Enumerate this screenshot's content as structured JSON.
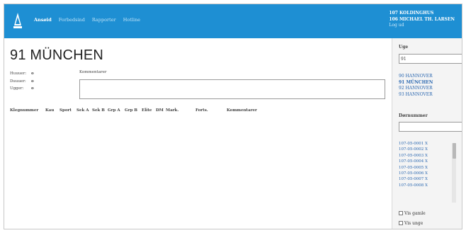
{
  "nav": {
    "items": [
      {
        "label": "Ansøid",
        "active": true
      },
      {
        "label": "Forbedsind",
        "active": false
      },
      {
        "label": "Rapporter",
        "active": false
      },
      {
        "label": "Hotline",
        "active": false
      }
    ]
  },
  "user": {
    "line1": "107 KOLDINGHUS",
    "line2": "106 MICHAEL TH. LARSEN",
    "logout": "Log ud"
  },
  "page_title": "91 MÜNCHEN",
  "meta": [
    {
      "label": "Huuuer:",
      "value": "o"
    },
    {
      "label": "Duuuer:",
      "value": "o"
    },
    {
      "label": "Ugger:",
      "value": "o"
    }
  ],
  "comment_label": "Kommentarer",
  "table_headers": [
    "Klegnummer",
    "Kau",
    "Sport",
    "Sek A",
    "Sek B",
    "Grp A",
    "Grp B",
    "Elite",
    "DM",
    "Mark.",
    "Forts.",
    "Kommentarer"
  ],
  "sidebar": {
    "uge_label": "Uge",
    "uge_value": "91",
    "uge_items": [
      {
        "label": "90 HANNOVER",
        "selected": false
      },
      {
        "label": "91 MÜNCHEN",
        "selected": true
      },
      {
        "label": "92 HANNOVER",
        "selected": false
      },
      {
        "label": "93 HANNOVER",
        "selected": false
      }
    ],
    "dok_label": "Dørnummer",
    "dok_value": "",
    "dok_items": [
      "107-05-0001 X",
      "107-05-0002 X",
      "107-05-0003 X",
      "107-05-0004 X",
      "107-05-0005 X",
      "107-05-0006 X",
      "107-05-0007 X",
      "107-05-0008 X"
    ],
    "check1": "Vis gamle",
    "check2": "Vis unge"
  }
}
